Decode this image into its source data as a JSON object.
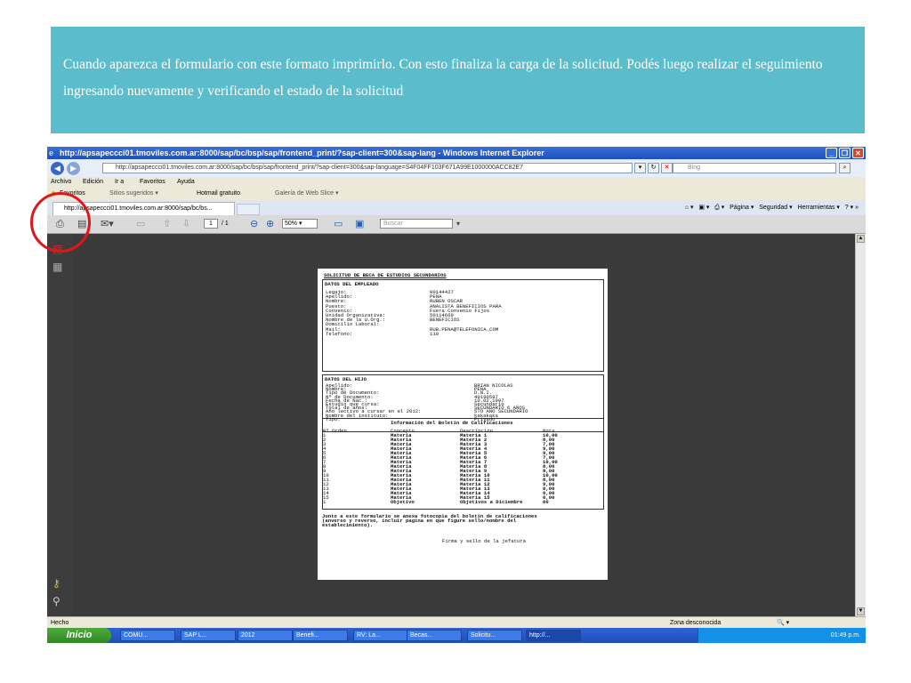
{
  "banner": {
    "text": "Cuando aparezca el formulario con este formato imprimirlo. Con esto finaliza la carga de la solicitud. Podés luego realizar el seguimiento ingresando nuevamente y verificando el estado de la solicitud"
  },
  "window": {
    "title": "http://apsapeccci01.tmoviles.com.ar:8000/sap/bc/bsp/sap/frontend_print/?sap-client=300&sap-lang - Windows Internet Explorer",
    "address": "http://apsapeccci01.tmoviles.com.ar:8000/sap/bc/bsp/sap/frontend_print/?sap-client=300&sap-language=S4F04FF103F671A99E1000000ACC82E7",
    "search_placeholder": "Bing"
  },
  "menu": [
    "Archivo",
    "Edición",
    "Ir a",
    "Favoritos",
    "Ayuda"
  ],
  "favorites_bar": {
    "favorites": "Favoritos",
    "items": [
      "Sitios sugeridos ▾",
      "Hotmail gratuito",
      "Galería de Web Slice ▾"
    ]
  },
  "tab": {
    "label": "http://apsapeccci01.tmoviles.com.ar:8000/sap/bc/bs..."
  },
  "commandbar": {
    "page": "Página ▾",
    "security": "Seguridad ▾",
    "tools": "Herramientas ▾"
  },
  "pdf_toolbar": {
    "page_current": "1",
    "page_total": "/ 1",
    "zoom": "50%",
    "find_placeholder": "Buscar"
  },
  "document": {
    "header": "SOLICITUD DE BECA DE ESTUDIOS SECUNDARIOS",
    "employee": {
      "title": "DATOS DEL EMPLEADO",
      "rows": [
        {
          "label": "Legajo:",
          "value": "00144427"
        },
        {
          "label": "Apellido:",
          "value": "PEÑA"
        },
        {
          "label": "Nombre:",
          "value": "RUBEN OSCAR"
        },
        {
          "label": "Puesto:",
          "value": "ANALISTA BENEFICIOS PARA"
        },
        {
          "label": "Convenio:",
          "value": "Fuera Convenio Fijos"
        },
        {
          "label": "Unidad Organizativa:",
          "value": "50114669"
        },
        {
          "label": "Nombre de la U.Org.:",
          "value": "BENEFICIOS"
        },
        {
          "label": "Domicilio Laboral:",
          "value": ""
        },
        {
          "label": "Mail:",
          "value": "RUB.PENA@TELEFONICA.COM"
        },
        {
          "label": "Telefono:",
          "value": "110"
        }
      ]
    },
    "child": {
      "title": "DATOS DEL HIJO",
      "rows": [
        {
          "label": "Apellido:",
          "value": "BRIAN NICOLAS"
        },
        {
          "label": "Nombre:",
          "value": "PEÑA"
        },
        {
          "label": "Tipo de Documento:",
          "value": "D.N.I."
        },
        {
          "label": "Nº de Documento:",
          "value": "40190597"
        },
        {
          "label": "Fecha de Nac.:",
          "value": "10.02.1997"
        },
        {
          "label": "Estudio que cursa:",
          "value": "Secundario"
        },
        {
          "label": "Total de años:",
          "value": "SECUNDARIO 6 AÑOS"
        },
        {
          "label": "Año lectivo a cursar en el 2012:",
          "value": "5TO AÑO SECUNDARIO"
        },
        {
          "label": "Nombre del instituto:",
          "value": "kakakaka"
        },
        {
          "label": "Tipo:",
          "value": "Privado"
        }
      ]
    },
    "grades": {
      "title": "Información del Boletín de Calificaciones",
      "columns": [
        "Nº Orden",
        "Concepto",
        "Descripción",
        "Nota"
      ],
      "rows": [
        [
          "1",
          "Materia",
          "Materia 1",
          "10,00"
        ],
        [
          "2",
          "Materia",
          "Materia 2",
          "8,00"
        ],
        [
          "3",
          "Materia",
          "Materia 3",
          "7,00"
        ],
        [
          "4",
          "Materia",
          "Materia 4",
          "9,00"
        ],
        [
          "5",
          "Materia",
          "Materia 5",
          "9,00"
        ],
        [
          "6",
          "Materia",
          "Materia 6",
          "7,00"
        ],
        [
          "7",
          "Materia",
          "Materia 7",
          "10,00"
        ],
        [
          "8",
          "Materia",
          "Materia 8",
          "8,00"
        ],
        [
          "9",
          "Materia",
          "Materia 9",
          "8,00"
        ],
        [
          "10",
          "Materia",
          "Materia 10",
          "10,00"
        ],
        [
          "11",
          "Materia",
          "Materia 11",
          "8,00"
        ],
        [
          "12",
          "Materia",
          "Materia 12",
          "9,00"
        ],
        [
          "13",
          "Materia",
          "Materia 13",
          "0,00"
        ],
        [
          "14",
          "Materia",
          "Materia 14",
          "0,00"
        ],
        [
          "15",
          "Materia",
          "Materia 15",
          "0,00"
        ],
        [
          "1",
          "Objetivo",
          "Objetivos a Diciembre",
          "00"
        ]
      ]
    },
    "footer_lines": [
      "Junto a este formulario se anexa fotocopia del boletín de calificaciones",
      "(anverso y reverso, incluir pagina en que figure sello/nombre del",
      "establecimiento)."
    ],
    "signature": "Firma y sello de la jefatura"
  },
  "status": {
    "left": "Hecho",
    "zone": "Zona desconocida"
  },
  "taskbar": {
    "start": "Inicio",
    "tasks": [
      "COMU...",
      "SAP L...",
      "2012",
      "Benefi...",
      "RV: La...",
      "Becas...",
      "Solicitu...",
      "http://..."
    ],
    "clock": "01:49 p.m."
  },
  "colors": {
    "banner": "#5bbccb",
    "highlight_circle": "#e0161b",
    "taskbar": "#2f63d6"
  }
}
